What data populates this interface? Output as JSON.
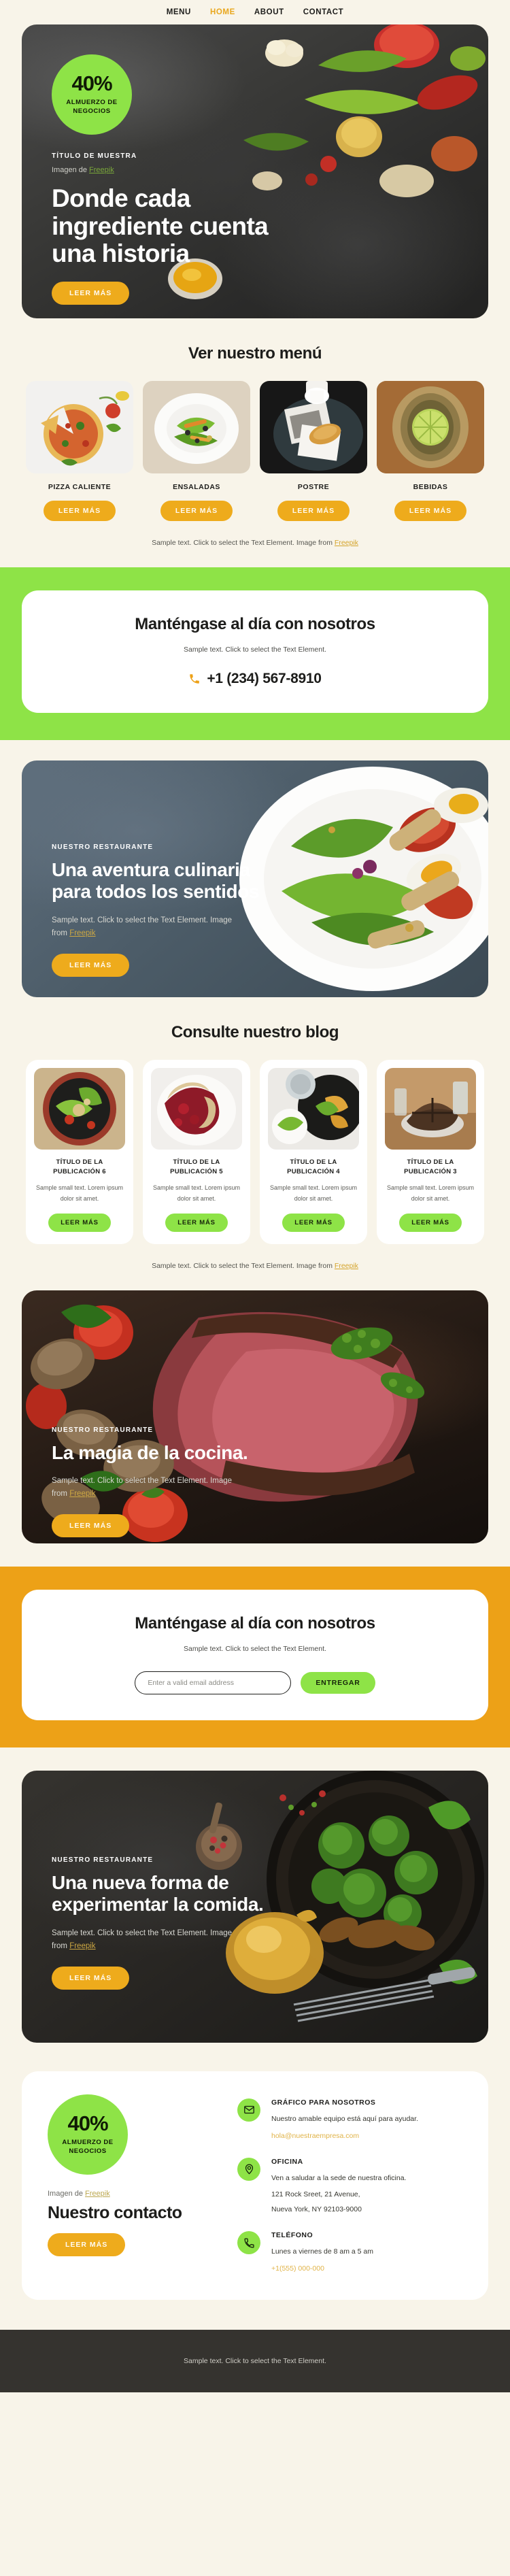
{
  "nav": {
    "items": [
      {
        "label": "MENU",
        "active": false
      },
      {
        "label": "HOME",
        "active": true
      },
      {
        "label": "ABOUT",
        "active": false
      },
      {
        "label": "CONTACT",
        "active": false
      }
    ]
  },
  "colors": {
    "page_bg": "#f8f4e9",
    "accent_orange": "#eda117",
    "accent_green": "#8ee347",
    "nav_active": "#e9a71d",
    "footer_bg": "#35332f",
    "link_gold": "#d4a42c"
  },
  "hero": {
    "badge": {
      "percent": "40%",
      "label": "ALMUERZO DE NEGOCIOS"
    },
    "eyebrow": "TÍTULO DE MUESTRA",
    "credit_prefix": "Imagen de ",
    "credit_link": "Freepik",
    "title": "Donde cada ingrediente cuenta una historia",
    "button": "LEER MÁS"
  },
  "menu_section": {
    "heading": "Ver nuestro menú",
    "cards": [
      {
        "name": "PIZZA CALIENTE",
        "button": "LEER MÁS"
      },
      {
        "name": "ENSALADAS",
        "button": "LEER MÁS"
      },
      {
        "name": "POSTRE",
        "button": "LEER MÁS"
      },
      {
        "name": "BEBIDAS",
        "button": "LEER MÁS"
      }
    ],
    "caption_prefix": "Sample text. Click to select the Text Element. Image from ",
    "caption_link": "Freepik"
  },
  "newsletter_green": {
    "heading": "Manténgase al día con nosotros",
    "sub": "Sample text. Click to select the Text Element.",
    "phone": "+1 (234) 567-8910",
    "phone_icon": "phone-icon"
  },
  "banner_adventure": {
    "eyebrow": "NUESTRO RESTAURANTE",
    "title": "Una aventura culinaria para todos los sentidos",
    "sub_prefix": "Sample text. Click to select the Text Element. Image from ",
    "sub_link": "Freepik",
    "button": "LEER MÁS"
  },
  "blog_section": {
    "heading": "Consulte nuestro blog",
    "cards": [
      {
        "title": "TÍTULO DE LA PUBLICACIÓN 6",
        "text": "Sample small text. Lorem ipsum dolor sit amet.",
        "button": "LEER MÁS"
      },
      {
        "title": "TÍTULO DE LA PUBLICACIÓN 5",
        "text": "Sample small text. Lorem ipsum dolor sit amet.",
        "button": "LEER MÁS"
      },
      {
        "title": "TÍTULO DE LA PUBLICACIÓN 4",
        "text": "Sample small text. Lorem ipsum dolor sit amet.",
        "button": "LEER MÁS"
      },
      {
        "title": "TÍTULO DE LA PUBLICACIÓN 3",
        "text": "Sample small text. Lorem ipsum dolor sit amet.",
        "button": "LEER MÁS"
      }
    ],
    "caption_prefix": "Sample text. Click to select the Text Element. Image from ",
    "caption_link": "Freepik"
  },
  "banner_magic": {
    "eyebrow": "NUESTRO RESTAURANTE",
    "title": "La magia de la cocina.",
    "sub_prefix": "Sample text. Click to select the Text Element. Image from ",
    "sub_link": "Freepik",
    "button": "LEER MÁS"
  },
  "newsletter_orange": {
    "heading": "Manténgase al día con nosotros",
    "sub": "Sample text. Click to select the Text Element.",
    "email_placeholder": "Enter a valid email address",
    "email_value": "",
    "submit": "ENTREGAR"
  },
  "banner_newway": {
    "eyebrow": "NUESTRO RESTAURANTE",
    "title": "Una nueva forma de experimentar la comida.",
    "sub_prefix": "Sample text. Click to select the Text Element. Image from ",
    "sub_link": "Freepik",
    "button": "LEER MÁS"
  },
  "contact": {
    "badge": {
      "percent": "40%",
      "label": "ALMUERZO DE NEGOCIOS"
    },
    "credit_prefix": "Imagen de ",
    "credit_link": "Freepik",
    "heading": "Nuestro contacto",
    "button": "LEER MÁS",
    "items": [
      {
        "icon": "envelope-icon",
        "title": "GRÁFICO PARA NOSOTROS",
        "text": "Nuestro amable equipo está aquí para ayudar.",
        "link": "hola@nuestraempresa.com",
        "line2": ""
      },
      {
        "icon": "map-pin-icon",
        "title": "OFICINA",
        "text": "Ven a saludar a la sede de nuestra oficina.",
        "link": "121 Rock Sreet, 21 Avenue,",
        "line2": "Nueva York, NY 92103-9000"
      },
      {
        "icon": "phone-icon",
        "title": "TELÉFONO",
        "text": "Lunes a viernes de 8 am a 5 am",
        "link": "+1(555) 000-000",
        "line2": ""
      }
    ]
  },
  "footer": {
    "text": "Sample text. Click to select the Text Element."
  }
}
